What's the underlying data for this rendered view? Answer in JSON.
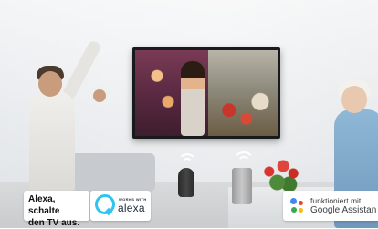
{
  "caption": {
    "line1": "Alexa, schalte",
    "line2": "den TV aus."
  },
  "alexa_badge": {
    "works_with": "WORKS WITH",
    "brand": "alexa",
    "ring_color": "#31c4f3"
  },
  "google_badge": {
    "line1": "funktioniert mit",
    "line2": "Google Assistan",
    "dot_colors": [
      "#4285f4",
      "#ea4335",
      "#fbbc05",
      "#34a853"
    ]
  },
  "icons": {
    "alexa": "alexa-ring-icon",
    "google": "google-assistant-icon",
    "wave": "wireless-wave-icon"
  }
}
